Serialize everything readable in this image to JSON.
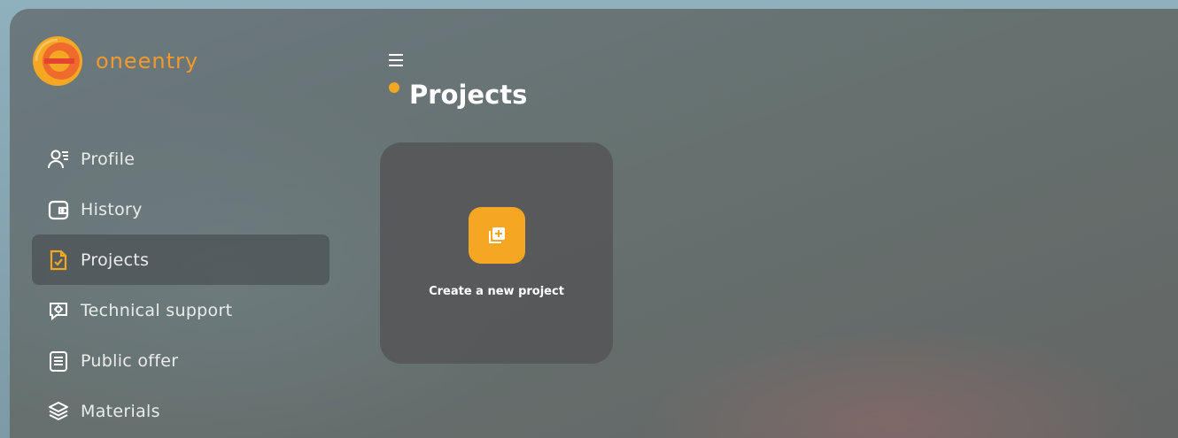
{
  "brand": {
    "name": "ONEENTRY",
    "accent": "#f5a623"
  },
  "sidebar": {
    "items": [
      {
        "label": "Profile",
        "icon": "profile-icon"
      },
      {
        "label": "History",
        "icon": "wallet-icon"
      },
      {
        "label": "Projects",
        "icon": "projects-icon",
        "active": true
      },
      {
        "label": "Technical support",
        "icon": "support-icon"
      },
      {
        "label": "Public offer",
        "icon": "document-icon"
      },
      {
        "label": "Materials",
        "icon": "layers-icon"
      }
    ]
  },
  "header": {
    "title": "Projects",
    "menu_icon": "hamburger-icon"
  },
  "main": {
    "new_project_card": {
      "label": "Create a new project",
      "icon": "add-project-icon"
    }
  }
}
